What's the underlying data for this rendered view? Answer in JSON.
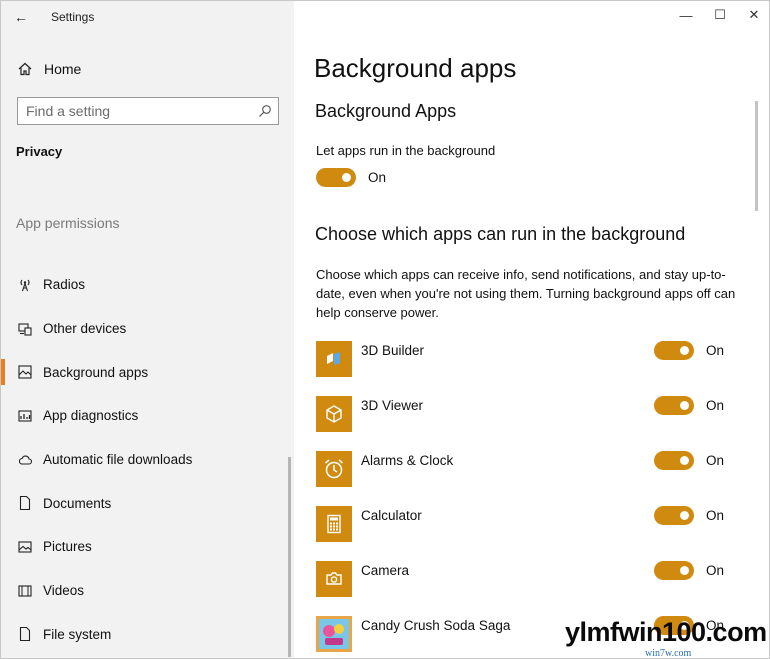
{
  "window": {
    "title": "Settings",
    "back_icon": "←",
    "minimize_icon": "—",
    "maximize_icon": "☐",
    "close_icon": "✕"
  },
  "sidebar": {
    "home_label": "Home",
    "search_placeholder": "Find a setting",
    "category": "Privacy",
    "section_label": "App permissions",
    "items": [
      {
        "label": "Radios",
        "icon": "radio-tower-icon"
      },
      {
        "label": "Other devices",
        "icon": "other-devices-icon"
      },
      {
        "label": "Background apps",
        "icon": "background-apps-icon",
        "selected": true
      },
      {
        "label": "App diagnostics",
        "icon": "app-diagnostics-icon"
      },
      {
        "label": "Automatic file downloads",
        "icon": "cloud-icon"
      },
      {
        "label": "Documents",
        "icon": "document-icon"
      },
      {
        "label": "Pictures",
        "icon": "picture-icon"
      },
      {
        "label": "Videos",
        "icon": "video-icon"
      },
      {
        "label": "File system",
        "icon": "file-icon"
      }
    ]
  },
  "main": {
    "page_title": "Background apps",
    "subtitle": "Background Apps",
    "let_apps_label": "Let apps run in the background",
    "let_apps_state": "On",
    "choose_title": "Choose which apps can run in the background",
    "description": "Choose which apps can receive info, send notifications, and stay up-to-date, even when you're not using them. Turning background apps off can help conserve power.",
    "apps": [
      {
        "name": "3D Builder",
        "state": "On",
        "icon": "3d-builder-icon"
      },
      {
        "name": "3D Viewer",
        "state": "On",
        "icon": "3d-viewer-icon"
      },
      {
        "name": "Alarms & Clock",
        "state": "On",
        "icon": "alarm-clock-icon"
      },
      {
        "name": "Calculator",
        "state": "On",
        "icon": "calculator-icon"
      },
      {
        "name": "Camera",
        "state": "On",
        "icon": "camera-icon"
      },
      {
        "name": "Candy Crush Soda Saga",
        "state": "On",
        "icon": "candy-crush-icon"
      }
    ]
  },
  "colors": {
    "accent": "#d08a0f",
    "sidebar_bg": "#f2f2f2",
    "selection_bar": "#e67e22"
  },
  "watermark": {
    "text": "ylmfwin100.com",
    "subtext": "win7w.com"
  }
}
